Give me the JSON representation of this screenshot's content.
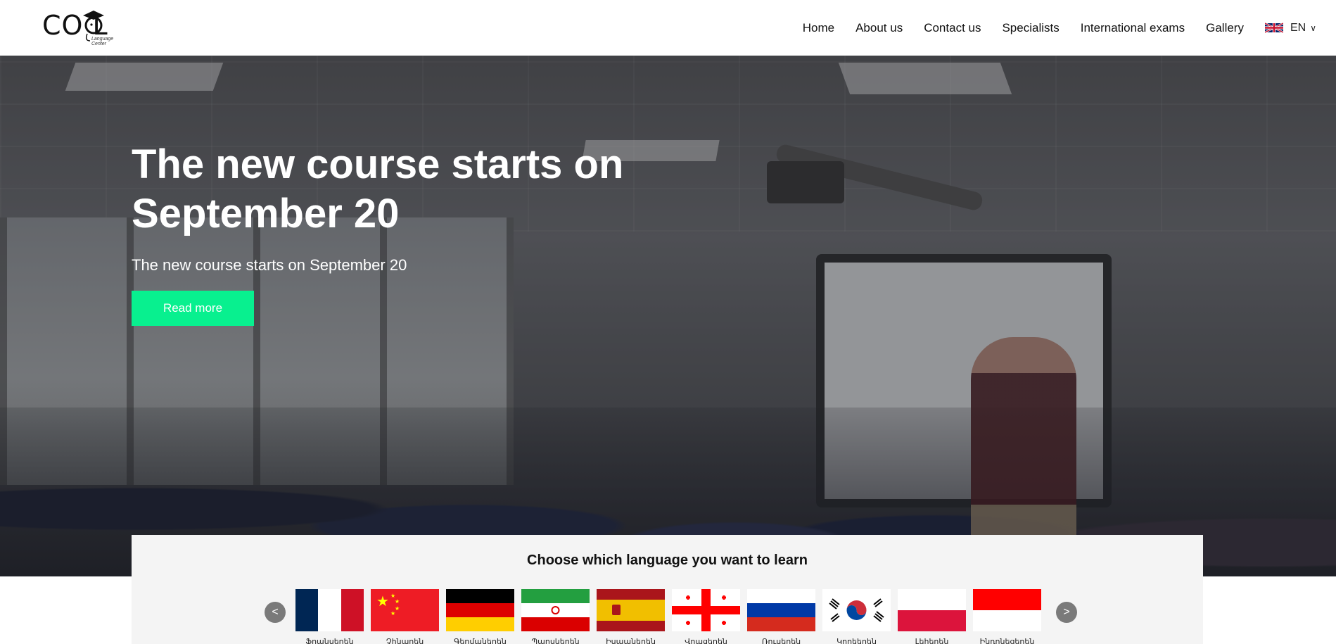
{
  "header": {
    "logo_text": "CO  L",
    "logo_sub": "Language Center",
    "nav": [
      "Home",
      "About us",
      "Contact us",
      "Specialists",
      "International exams",
      "Gallery"
    ],
    "language": "EN"
  },
  "hero": {
    "title": "The new course starts on September 20",
    "subtitle": "The new course starts on September 20",
    "button": "Read more"
  },
  "languages": {
    "title": "Choose which language you want to learn",
    "prev": "<",
    "next": ">",
    "items": [
      {
        "name": "french",
        "label": "Ֆրանսերեն"
      },
      {
        "name": "chinese",
        "label": "Չինարեն"
      },
      {
        "name": "german",
        "label": "Գերմաներեն"
      },
      {
        "name": "persian",
        "label": "Պարսկերեն"
      },
      {
        "name": "spanish",
        "label": "Իսպաներեն"
      },
      {
        "name": "georgian",
        "label": "Վրացերեն"
      },
      {
        "name": "russian",
        "label": "Ռուսերեն"
      },
      {
        "name": "korean",
        "label": "Կորեերեն"
      },
      {
        "name": "polish",
        "label": "Լեհերեն"
      },
      {
        "name": "indonesian",
        "label": "Ինդոնեզերեն"
      }
    ]
  },
  "colors": {
    "accent": "#08f08f",
    "panel": "#f4f4f4"
  }
}
